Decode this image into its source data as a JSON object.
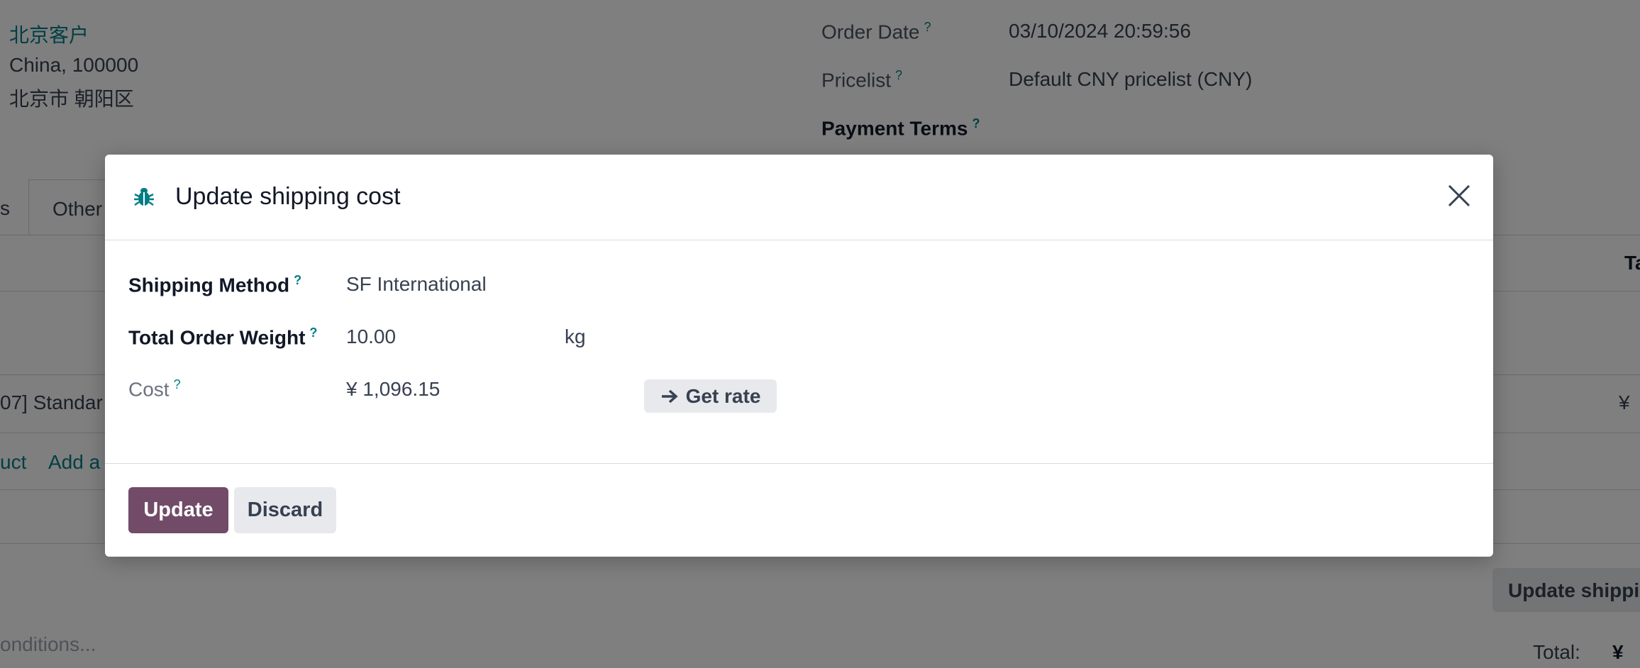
{
  "background": {
    "partner": {
      "name": "北京客户",
      "line2": "China, 100000",
      "line3": "北京市 朝阳区"
    },
    "fields": {
      "order_date_label": "Order Date",
      "order_date_value": "03/10/2024 20:59:56",
      "pricelist_label": "Pricelist",
      "pricelist_value": "Default CNY pricelist (CNY)",
      "payment_terms_label": "Payment Terms",
      "help_mark": "?"
    },
    "tabs": {
      "partial_left": "s",
      "other": "Other"
    },
    "table": {
      "header_partial": "Ta",
      "row_partial": "07] Standar",
      "row_amount_partial": "¥",
      "add_product_partial": "uct",
      "add_section_partial": "Add a"
    },
    "update_shipping_button": "Update shippi",
    "terms_placeholder": "onditions...",
    "total_label": "Total:",
    "total_value_partial": "¥ "
  },
  "modal": {
    "title": "Update shipping cost",
    "icon": "bug-icon",
    "close_icon": "close-icon",
    "help_mark": "?",
    "shipping_method": {
      "label": "Shipping Method",
      "value": "SF International"
    },
    "total_weight": {
      "label": "Total Order Weight",
      "value": "10.00",
      "unit": "kg"
    },
    "cost": {
      "label": "Cost",
      "value": "¥ 1,096.15"
    },
    "get_rate": {
      "icon": "arrow-right-icon",
      "label": "Get rate"
    },
    "buttons": {
      "update": "Update",
      "discard": "Discard"
    }
  },
  "colors": {
    "primary": "#714b67",
    "link": "#017e84",
    "overlay": "rgba(0,0,0,0.5)"
  }
}
